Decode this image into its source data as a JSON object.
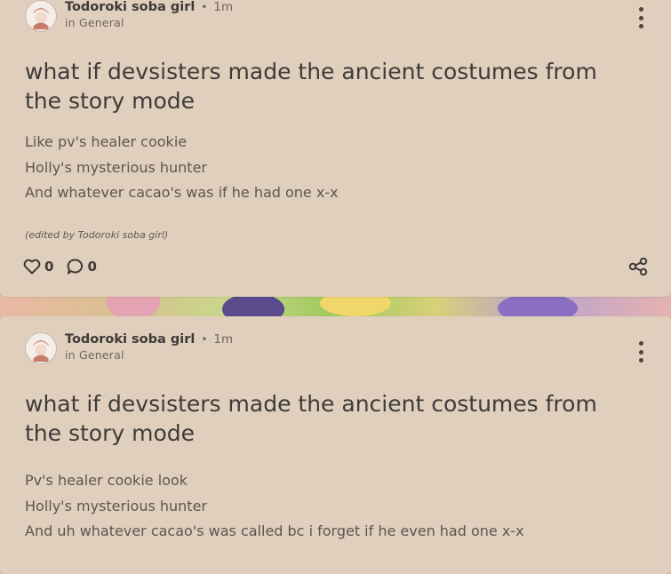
{
  "posts": [
    {
      "author": "Todoroki soba girl",
      "time": "1m",
      "category": "in General",
      "title": "what if devsisters made the ancient costumes from the story mode",
      "body": [
        "Like pv's healer cookie",
        "Holly's mysterious hunter",
        "And whatever cacao's was if he had one x-x"
      ],
      "edited_note": "(edited by Todoroki soba girl)",
      "likes": "0",
      "comments": "0"
    },
    {
      "author": "Todoroki soba girl",
      "time": "1m",
      "category": "in General",
      "title": "what if devsisters made the ancient costumes from the story mode",
      "body": [
        "Pv's healer cookie look",
        "Holly's mysterious hunter",
        "And uh whatever cacao's was called bc i forget if he even had one x-x"
      ]
    }
  ],
  "icons": {
    "like": "heart-icon",
    "comment": "comment-bubble-icon",
    "share": "share-icon",
    "more": "more-vertical-icon"
  },
  "colors": {
    "card_background": "#e0cfbd",
    "text_primary": "#3f3b38",
    "text_secondary": "#6e665f"
  }
}
